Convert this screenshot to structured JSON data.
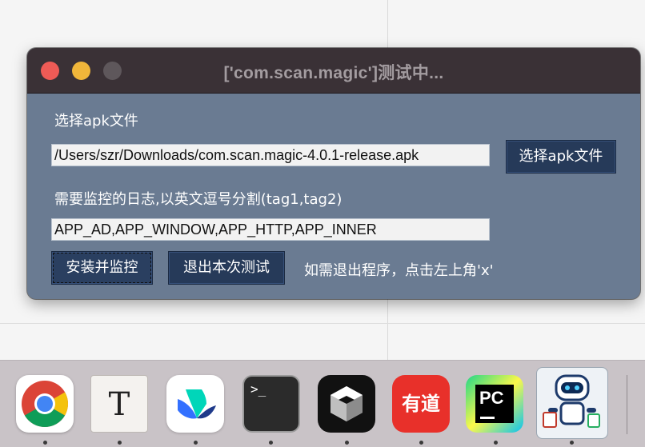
{
  "window": {
    "title": "['com.scan.magic']测试中..."
  },
  "form": {
    "apk_label": "选择apk文件",
    "apk_path": "/Users/szr/Downloads/com.scan.magic-4.0.1-release.apk",
    "choose_apk_button": "选择apk文件",
    "log_label": "需要监控的日志,以英文逗号分割(tag1,tag2)",
    "log_tags": "APP_AD,APP_WINDOW,APP_HTTP,APP_INNER",
    "install_button": "安装并监控",
    "exit_button": "退出本次测试",
    "hint": "如需退出程序，点击左上角'x'"
  },
  "dock": {
    "items": [
      {
        "icon": "chrome-icon"
      },
      {
        "icon": "typora-icon",
        "glyph": "T"
      },
      {
        "icon": "feishu-icon"
      },
      {
        "icon": "terminal-icon",
        "glyph": ">_"
      },
      {
        "icon": "cube-app-icon"
      },
      {
        "icon": "youdao-icon",
        "glyph": "有道"
      },
      {
        "icon": "pycharm-icon",
        "glyph": "PC"
      },
      {
        "icon": "robot-app-icon"
      }
    ]
  },
  "colors": {
    "window_bg": "#6a7b92",
    "titlebar_bg": "#3a3136",
    "button_bg": "#263a59",
    "close": "#ee5b56",
    "minimize": "#f0b63a"
  }
}
